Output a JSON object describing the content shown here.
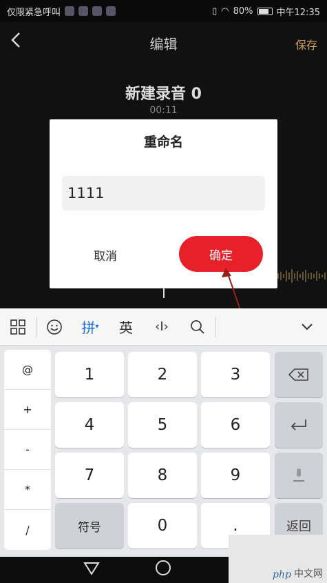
{
  "status_bar": {
    "left_text": "仅限紧急呼叫",
    "battery": "80%",
    "time": "中午12:35"
  },
  "header": {
    "title": "编辑",
    "save_label": "保存"
  },
  "recording": {
    "name": "新建录音 0",
    "duration": "00:11"
  },
  "dialog": {
    "title": "重命名",
    "input_value": "1111",
    "cancel_label": "取消",
    "ok_label": "确定"
  },
  "keyboard": {
    "toolbar": {
      "pinyin": "拼",
      "english": "英"
    },
    "symbols": [
      "@",
      "+",
      "-",
      "*",
      "/"
    ],
    "digits": [
      "1",
      "2",
      "3",
      "4",
      "5",
      "6",
      "7",
      "8",
      "9",
      "0"
    ],
    "symbol_key": "符号",
    "dot_key": ".",
    "return_key": "返回"
  },
  "watermark": {
    "logo": "php",
    "text": "中文网"
  },
  "colors": {
    "accent_red": "#e8202a",
    "save_gold": "#c9a15a",
    "kbd_blue": "#1e6fd9"
  }
}
